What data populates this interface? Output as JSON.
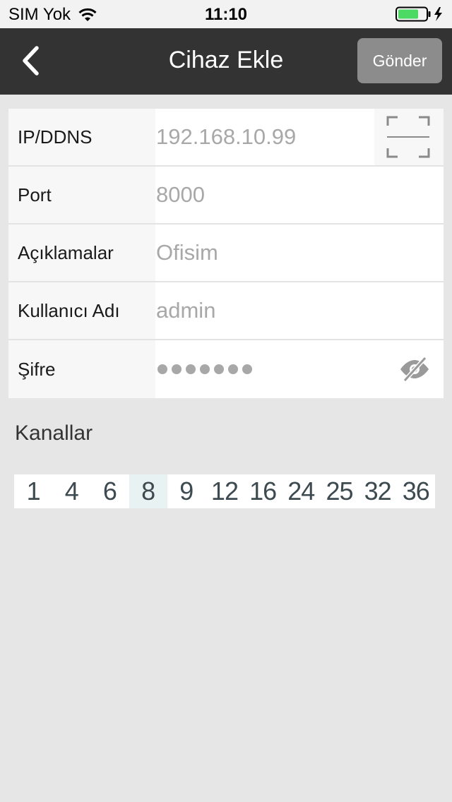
{
  "status_bar": {
    "carrier": "SIM Yok",
    "time": "11:10",
    "wifi_icon": "wifi-icon",
    "battery_icon": "battery-charging-icon",
    "battery_color": "#4cd964"
  },
  "nav": {
    "back_icon": "chevron-left-icon",
    "title": "Cihaz Ekle",
    "send_label": "Gönder",
    "background": "#333333"
  },
  "form": {
    "rows": [
      {
        "label": "IP/DDNS",
        "placeholder": "192.168.10.99",
        "value": ""
      },
      {
        "label": "Port",
        "placeholder": "8000",
        "value": ""
      },
      {
        "label": "Açıklamalar",
        "placeholder": "Ofisim",
        "value": ""
      },
      {
        "label": "Kullanıcı Adı",
        "placeholder": "admin",
        "value": ""
      },
      {
        "label": "Şifre",
        "masked_length": 7,
        "visibility_icon": "eye-off-icon"
      }
    ],
    "scan_icon": "qr-scan-icon"
  },
  "channels": {
    "title": "Kanallar",
    "options": [
      "1",
      "4",
      "6",
      "8",
      "9",
      "12",
      "16",
      "24",
      "25",
      "32",
      "36"
    ],
    "selected": "8",
    "selected_color": "#e9f2f2"
  }
}
